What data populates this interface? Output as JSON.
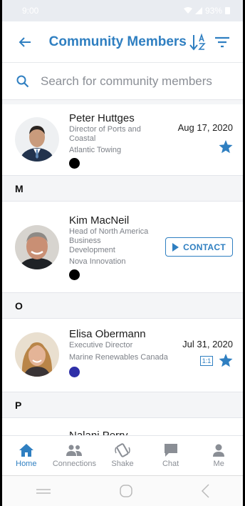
{
  "status": {
    "time": "9:00",
    "battery": "93%"
  },
  "header": {
    "title": "Community Members"
  },
  "search": {
    "placeholder": "Search for community members"
  },
  "members": [
    {
      "name": "Peter Huttges",
      "role": "Director of Ports and Coastal",
      "org": "Atlantic Towing",
      "date": "Aug 17, 2020",
      "dot_color": "#000000",
      "starred": true
    },
    {
      "name": "Kim MacNeil",
      "role": "Head of North America Business Development",
      "org": "Nova Innovation",
      "dot_color": "#000000",
      "contact_label": "CONTACT"
    },
    {
      "name": "Elisa Obermann",
      "role": "Executive Director",
      "org": "Marine Renewables Canada",
      "date": "Jul 31, 2020",
      "dot_color": "#2e2fa8",
      "badge": "1:1",
      "starred": true
    },
    {
      "name": "Nalani Perry"
    }
  ],
  "sections": [
    "M",
    "O",
    "P"
  ],
  "tabs": [
    {
      "label": "Home",
      "icon": "home-icon",
      "active": true
    },
    {
      "label": "Connections",
      "icon": "connections-icon"
    },
    {
      "label": "Shake",
      "icon": "shake-icon"
    },
    {
      "label": "Chat",
      "icon": "chat-icon"
    },
    {
      "label": "Me",
      "icon": "person-icon"
    }
  ],
  "colors": {
    "accent": "#2f7fc1",
    "muted": "#8a8e95"
  }
}
